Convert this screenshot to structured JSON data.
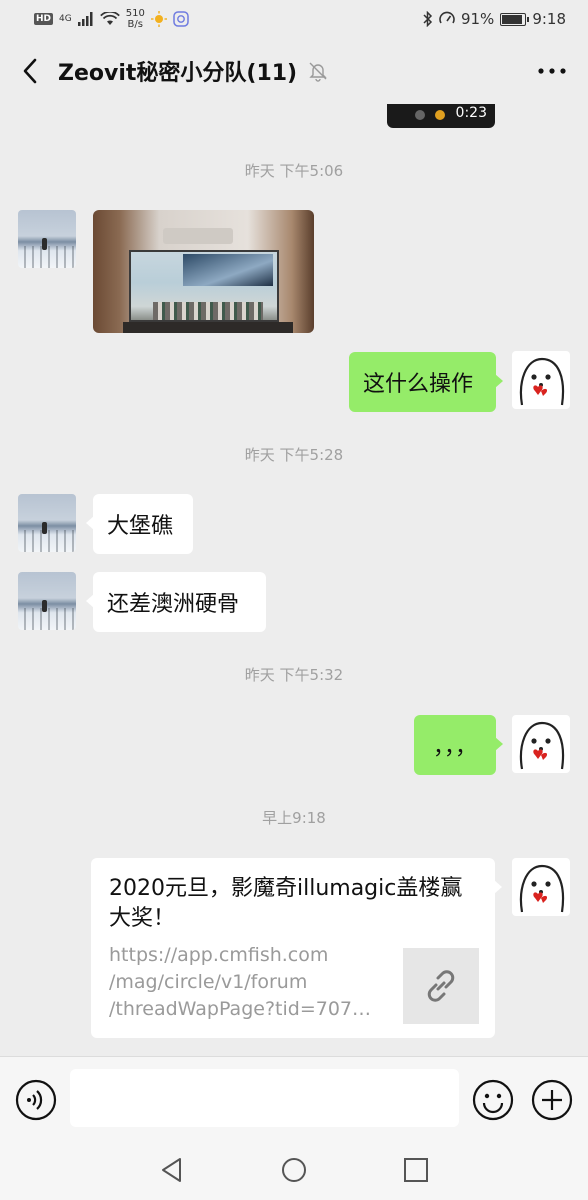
{
  "status_bar": {
    "hd": "HD",
    "network": "4G",
    "net_speed_value": "510",
    "net_speed_unit": "B/s",
    "battery_percent": "91%",
    "battery_level": 0.91,
    "time": "9:18"
  },
  "header": {
    "title": "Zeovit秘密小分队(11)",
    "muted": true
  },
  "video": {
    "duration": "0:23"
  },
  "messages": {
    "ts1": "昨天 下午5:06",
    "msg2": "这什么操作",
    "ts2": "昨天 下午5:28",
    "msg3": "大堡礁",
    "msg4": "还差澳洲硬骨",
    "ts3": "昨天 下午5:32",
    "msg5": "，，，",
    "ts4": "早上9:18",
    "link": {
      "title": "2020元旦，影魔奇illumagic盖楼赢大奖！",
      "url_line1": "https://app.cmfish.com",
      "url_line2": "/mag/circle/v1/forum",
      "url_line3": "/threadWapPage?tid=7078..."
    }
  },
  "input": {
    "value": "",
    "placeholder": ""
  },
  "colors": {
    "background": "#ededed",
    "bubble_self": "#95ec69",
    "bubble_other": "#ffffff",
    "timestamp": "#a0a0a0"
  },
  "icons": {
    "back": "chevron-left-icon",
    "mute": "bell-off-icon",
    "more": "more-icon",
    "voice": "voice-icon",
    "emoji": "emoji-icon",
    "plus": "plus-icon",
    "link": "link-icon"
  }
}
